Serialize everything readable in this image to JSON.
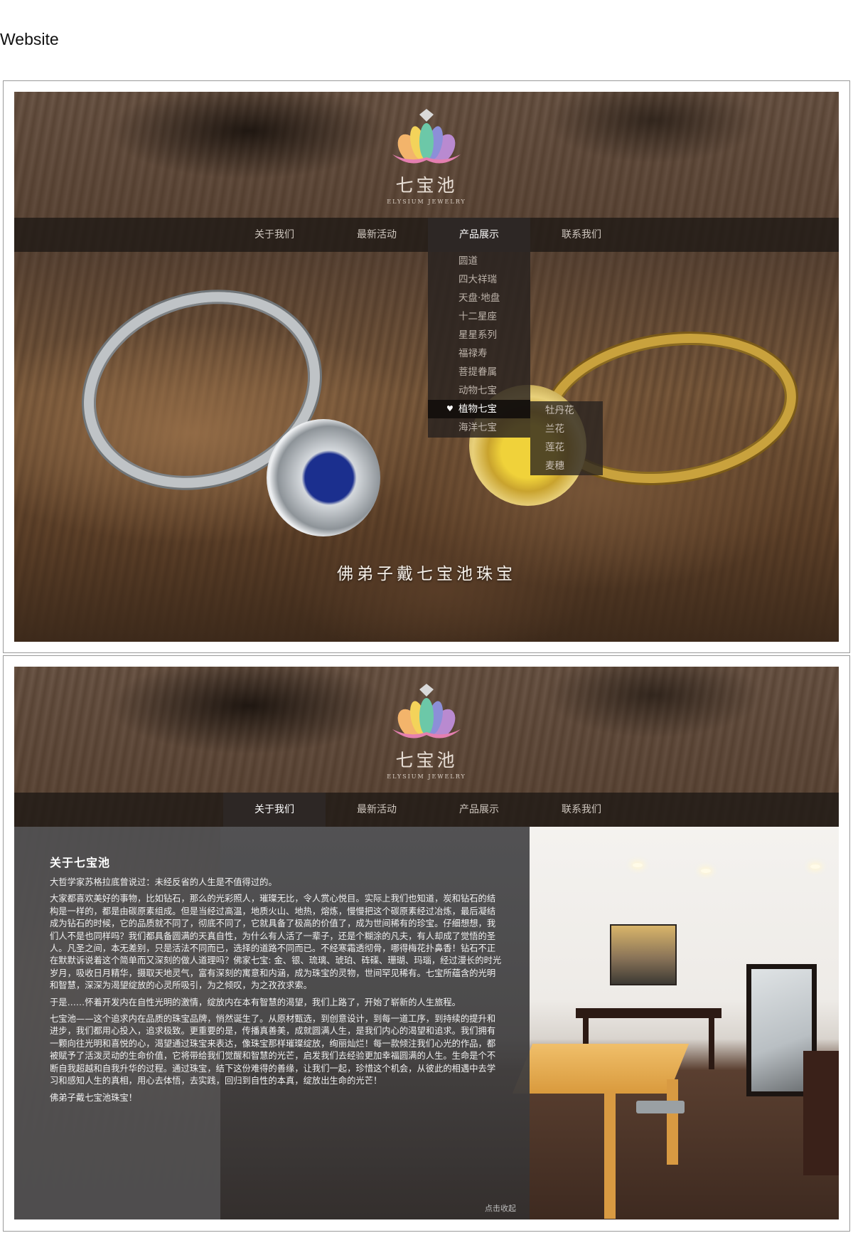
{
  "page_title": "Website",
  "logo": {
    "name": "七宝池",
    "subtitle": "ELYSIUM JEWELRY"
  },
  "nav": {
    "items": [
      "关于我们",
      "最新活动",
      "产品展示",
      "联系我们"
    ]
  },
  "screen1": {
    "active_nav": "产品展示",
    "dropdown": [
      "圆道",
      "四大祥瑞",
      "天盘·地盘",
      "十二星座",
      "星星系列",
      "福禄寿",
      "菩提眷属",
      "动物七宝",
      "植物七宝",
      "海洋七宝"
    ],
    "dropdown_hover": "植物七宝",
    "submenu": [
      "牡丹花",
      "兰花",
      "莲花",
      "麦穗"
    ],
    "slogan": "佛弟子戴七宝池珠宝"
  },
  "screen2": {
    "active_nav": "关于我们",
    "about": {
      "title": "关于七宝池",
      "paragraphs": [
        "大哲学家苏格拉底曾说过：未经反省的人生是不值得过的。",
        "大家都喜欢美好的事物，比如钻石，那么的光彩照人，璀璨无比，令人赏心悦目。实际上我们也知道，炭和钻石的结构是一样的，都是由碳原素组成。但是当经过高温，地质火山、地热，熔炼，慢慢把这个碳原素经过冶炼，最后凝结成为钻石的时候，它的品质就不同了，彻底不同了，它就具备了极高的价值了，成为世间稀有的珍宝。仔细想想，我们人不是也同样吗？我们都具备圆满的天真自性，为什么有人活了一辈子，还是个糊涂的凡夫，有人却成了觉悟的圣人。凡圣之间，本无差别，只是活法不同而已，选择的道路不同而已。不经寒霜透彻骨，哪得梅花扑鼻香！钻石不正在默默诉说着这个简单而又深刻的做人道理吗？佛家七宝: 金、银、琉璃、琥珀、砗磲、珊瑚、玛瑙，经过漫长的时光岁月，吸收日月精华，摄取天地灵气，富有深刻的寓意和内涵，成为珠宝的灵物，世间罕见稀有。七宝所蕴含的光明和智慧，深深为渴望绽放的心灵所吸引，为之倾叹，为之孜孜求索。",
        "于是……怀着开发内在自性光明的激情，绽放内在本有智慧的渴望，我们上路了，开始了崭新的人生旅程。",
        "七宝池——这个追求内在品质的珠宝品牌，悄然诞生了。从原材甄选，到创意设计，到每一道工序，到持续的提升和进步，我们都用心投入，追求极致。更重要的是，传播真善美，成就圆满人生，是我们内心的渴望和追求。我们拥有一颗向往光明和喜悦的心，渴望通过珠宝来表达，像珠宝那样璀璨绽放，绚丽灿烂！每一款倾注我们心光的作品，都被赋予了活泼灵动的生命价值，它将带给我们觉醒和智慧的光芒，启发我们去经验更加幸福圆满的人生。生命是个不断自我超越和自我升华的过程。通过珠宝，结下这份难得的善缘，让我们一起，珍惜这个机会，从彼此的相遇中去学习和感知人生的真相，用心去体悟，去实践，回归到自性的本真，绽放出生命的光芒！",
        "佛弟子戴七宝池珠宝！"
      ],
      "collapse": "点击收起"
    }
  },
  "colors": {
    "nav_bg": "#1e1814",
    "panel_bg": "#505052",
    "text_light": "#ffffff"
  }
}
